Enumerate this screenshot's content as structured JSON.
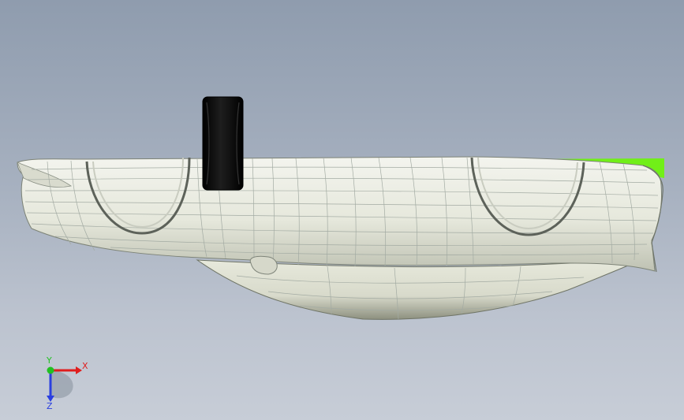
{
  "viewport": {
    "background_top": "#8f9cae",
    "background_bottom": "#c7cdd7"
  },
  "model": {
    "body_color": "#e9ebe1",
    "body_shade": "#c9cbbe",
    "mesh_color": "#9aa39b",
    "highlight_color": "#71ef18",
    "wheel_color": "#0a0a0a"
  },
  "triad": {
    "x_label": "X",
    "y_label": "Y",
    "z_label": "Z",
    "x_color": "#e01d1d",
    "y_color": "#22c022",
    "z_color": "#2a3fe0"
  }
}
